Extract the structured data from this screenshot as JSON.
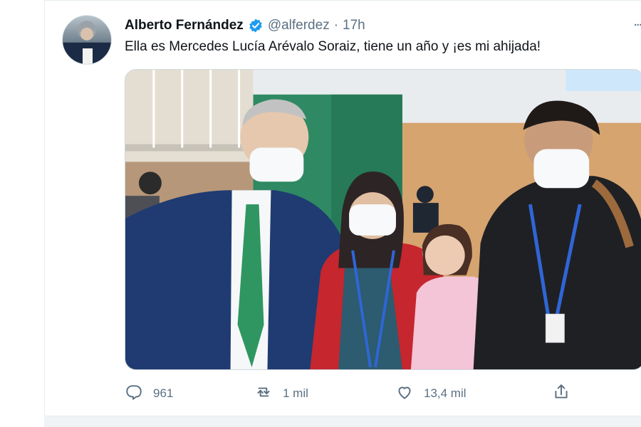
{
  "tweet": {
    "author_name": "Alberto Fernández",
    "handle": "@alferdez",
    "separator": "·",
    "time": "17h",
    "more": "...",
    "text": "Ella es Mercedes Lucía Arévalo Soraiz, tiene un año y ¡es mi ahijada!",
    "verified_color": "#1d9bf0",
    "icons": {
      "verified": "verified-badge-icon",
      "reply": "reply-icon",
      "retweet": "retweet-icon",
      "like": "heart-icon",
      "share": "share-icon"
    }
  },
  "actions": {
    "replies": "961",
    "retweets": "1 mil",
    "likes": "13,4 mil"
  },
  "colors": {
    "text": "#0f1419",
    "muted": "#5b7083",
    "accent": "#1d9bf0"
  }
}
